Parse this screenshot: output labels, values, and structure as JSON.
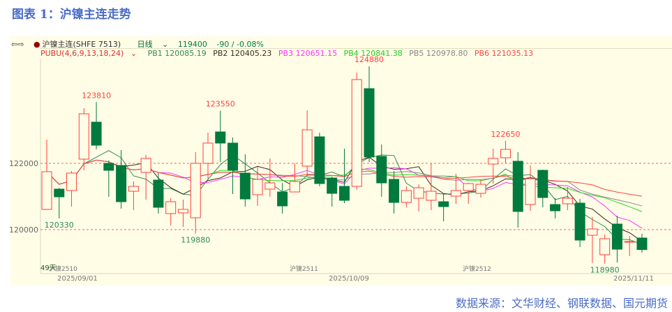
{
  "title": "图表 1：沪镍主连走势",
  "header": {
    "nav_icon": "arrows-icon",
    "symbol": "沪镍主连(SHFE 7513)",
    "period": "日线",
    "last": "119400",
    "change": "-90 / -0.08%",
    "indicator": "PUBU(4,6,9,13,18,24)",
    "pb": [
      {
        "label": "PB1 120085.19",
        "color": "#2e8b57"
      },
      {
        "label": "PB2 120405.23",
        "color": "#3a2a20"
      },
      {
        "label": "PB3 120651.15",
        "color": "#ff33ff"
      },
      {
        "label": "PB4 120841.38",
        "color": "#22dd22"
      },
      {
        "label": "PB5 120978.80",
        "color": "#888888"
      },
      {
        "label": "PB6 121035.13",
        "color": "#ff4444"
      }
    ]
  },
  "footer": {
    "days": "49天",
    "contracts": [
      "沪镍2510",
      "沪镍2511",
      "沪镍2512"
    ],
    "dates": [
      "2025/09/01",
      "2025/10/09",
      "2025/11/11"
    ]
  },
  "source": "数据来源：文华财经、钢联数据、国元期货",
  "colors": {
    "up": "#ff4040",
    "down": "#007a3d",
    "grid": "#ff6060"
  },
  "chart_data": {
    "type": "candlestick",
    "title": "沪镍主连走势",
    "yticks": [
      "122000",
      "120000"
    ],
    "ylim": [
      118800,
      125000
    ],
    "annotations": [
      {
        "index": 4,
        "text": "123810",
        "pos": "high"
      },
      {
        "index": 1,
        "text": "120330",
        "pos": "low"
      },
      {
        "index": 12,
        "text": "119880",
        "pos": "low"
      },
      {
        "index": 14,
        "text": "123550",
        "pos": "high"
      },
      {
        "index": 26,
        "text": "124880",
        "pos": "high"
      },
      {
        "index": 37,
        "text": "122650",
        "pos": "high"
      },
      {
        "index": 45,
        "text": "118980",
        "pos": "low"
      }
    ],
    "ohlc": [
      [
        120601,
        121728,
        122688,
        120601
      ],
      [
        121207,
        120977,
        121248,
        120330
      ],
      [
        121165,
        121687,
        121749,
        120685
      ],
      [
        122104,
        123461,
        123627,
        121770
      ],
      [
        123210,
        122521,
        123810,
        122396
      ],
      [
        121979,
        121770,
        122062,
        120977
      ],
      [
        121916,
        120831,
        122375,
        120622
      ],
      [
        121144,
        121290,
        121436,
        120580
      ],
      [
        121707,
        122125,
        122229,
        120893
      ],
      [
        121478,
        120664,
        121687,
        120476
      ],
      [
        120476,
        120831,
        120935,
        120121
      ],
      [
        120497,
        120601,
        120893,
        120080
      ],
      [
        120351,
        121979,
        122313,
        119880
      ],
      [
        121979,
        122584,
        122897,
        121519
      ],
      [
        122918,
        122584,
        123550,
        122020
      ],
      [
        122584,
        121770,
        122751,
        121060
      ],
      [
        121687,
        120914,
        122250,
        120685
      ],
      [
        121040,
        121499,
        121874,
        120706
      ],
      [
        121207,
        121394,
        122125,
        120977
      ],
      [
        121123,
        120706,
        121394,
        120476
      ],
      [
        121123,
        121436,
        121979,
        121123
      ],
      [
        121895,
        122980,
        123565,
        121582
      ],
      [
        122772,
        121374,
        122897,
        121290
      ],
      [
        121540,
        121081,
        121582,
        120685
      ],
      [
        121290,
        120873,
        122417,
        120789
      ],
      [
        121290,
        124483,
        124692,
        121186
      ],
      [
        124212,
        122167,
        124880,
        122020
      ],
      [
        122188,
        121394,
        122542,
        120977
      ],
      [
        121499,
        120810,
        121749,
        120476
      ],
      [
        120810,
        121165,
        121290,
        120664
      ],
      [
        120935,
        121248,
        121352,
        120539
      ],
      [
        120873,
        121144,
        121979,
        120580
      ],
      [
        120831,
        120685,
        121081,
        120247
      ],
      [
        120998,
        121165,
        121666,
        120768
      ],
      [
        121165,
        121374,
        121394,
        120768
      ],
      [
        121081,
        121352,
        121499,
        120956
      ],
      [
        121958,
        122125,
        122417,
        121374
      ],
      [
        122146,
        122396,
        122650,
        121979
      ],
      [
        122041,
        120539,
        122313,
        120059
      ],
      [
        120747,
        121519,
        121916,
        120560
      ],
      [
        121770,
        120956,
        121791,
        120664
      ],
      [
        120747,
        120560,
        120935,
        120330
      ],
      [
        120768,
        120935,
        121269,
        120580
      ],
      [
        120789,
        119683,
        120914,
        119474
      ],
      [
        119829,
        120017,
        120372,
        119000
      ],
      [
        119245,
        119725,
        119850,
        118980
      ],
      [
        120163,
        119412,
        120413,
        119015
      ],
      [
        119641,
        119641,
        119808,
        119203
      ],
      [
        119746,
        119400,
        119871,
        119307
      ]
    ],
    "ma_periods": [
      4,
      6,
      9,
      13,
      18,
      24
    ]
  }
}
